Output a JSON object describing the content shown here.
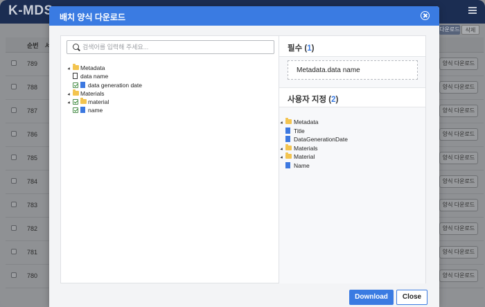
{
  "app": {
    "logo": "K-MDS",
    "toolbar": {
      "download_label": "다운로드",
      "delete_label": "삭제"
    },
    "table": {
      "col_number": "순번",
      "col_second": "서",
      "row_button_label": "양식 다운로드",
      "rows": [
        "789",
        "788",
        "787",
        "786",
        "785",
        "784",
        "783",
        "782",
        "781",
        "780"
      ]
    }
  },
  "modal": {
    "title": "배치 양식 다운로드",
    "search": {
      "placeholder": "검색어를 입력해 주세요..."
    },
    "tree": [
      {
        "label": "Metadata",
        "type": "folder",
        "expanded": true,
        "checked": false
      },
      {
        "label": "data name",
        "type": "file-outline",
        "checked": false
      },
      {
        "label": "data generation date",
        "type": "file",
        "checked": true
      },
      {
        "label": "Materials",
        "type": "folder",
        "expanded": true,
        "checked": false
      },
      {
        "label": "material",
        "type": "folder",
        "expanded": true,
        "checked": true
      },
      {
        "label": "name",
        "type": "file",
        "checked": true
      }
    ],
    "required": {
      "title": "필수",
      "count": "1",
      "items": [
        "Metadata.data name"
      ]
    },
    "custom": {
      "title": "사용자 지정",
      "count": "2",
      "tree": [
        {
          "label": "Metadata",
          "type": "folder"
        },
        {
          "label": "Title",
          "type": "file"
        },
        {
          "label": "DataGenerationDate",
          "type": "file"
        },
        {
          "label": "Materials",
          "type": "folder"
        },
        {
          "label": "Material",
          "type": "folder"
        },
        {
          "label": "Name",
          "type": "file"
        }
      ]
    },
    "buttons": {
      "download": "Download",
      "close": "Close"
    }
  },
  "colors": {
    "accent": "#3a7be2",
    "header_dark": "#1b2d52",
    "folder": "#f3c44f",
    "file": "#3c78e0"
  }
}
